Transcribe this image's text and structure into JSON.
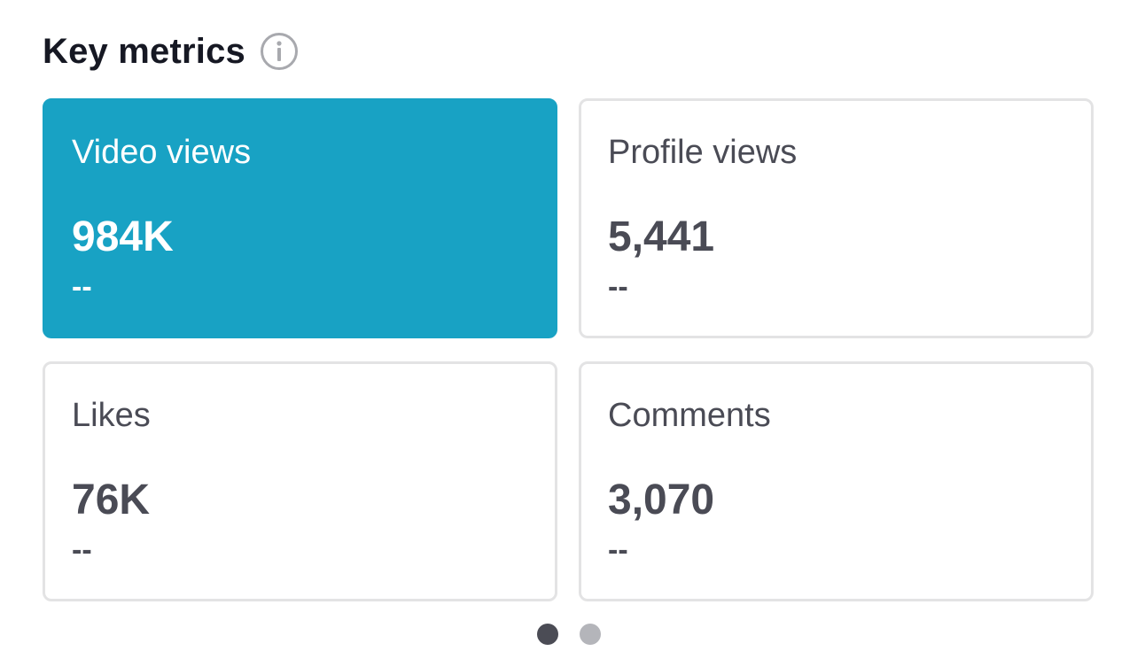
{
  "section": {
    "title": "Key metrics",
    "info_icon": "info-circle-icon"
  },
  "metrics": [
    {
      "label": "Video views",
      "value": "984K",
      "delta": "--",
      "selected": true
    },
    {
      "label": "Profile views",
      "value": "5,441",
      "delta": "--",
      "selected": false
    },
    {
      "label": "Likes",
      "value": "76K",
      "delta": "--",
      "selected": false
    },
    {
      "label": "Comments",
      "value": "3,070",
      "delta": "--",
      "selected": false
    }
  ],
  "pagination": {
    "pages": 2,
    "current": 1
  },
  "colors": {
    "accent": "#18a2c4",
    "text": "#4a4b55",
    "border": "#e3e3e4",
    "dot_active": "#4b4c55",
    "dot_inactive": "#b4b5ba"
  }
}
